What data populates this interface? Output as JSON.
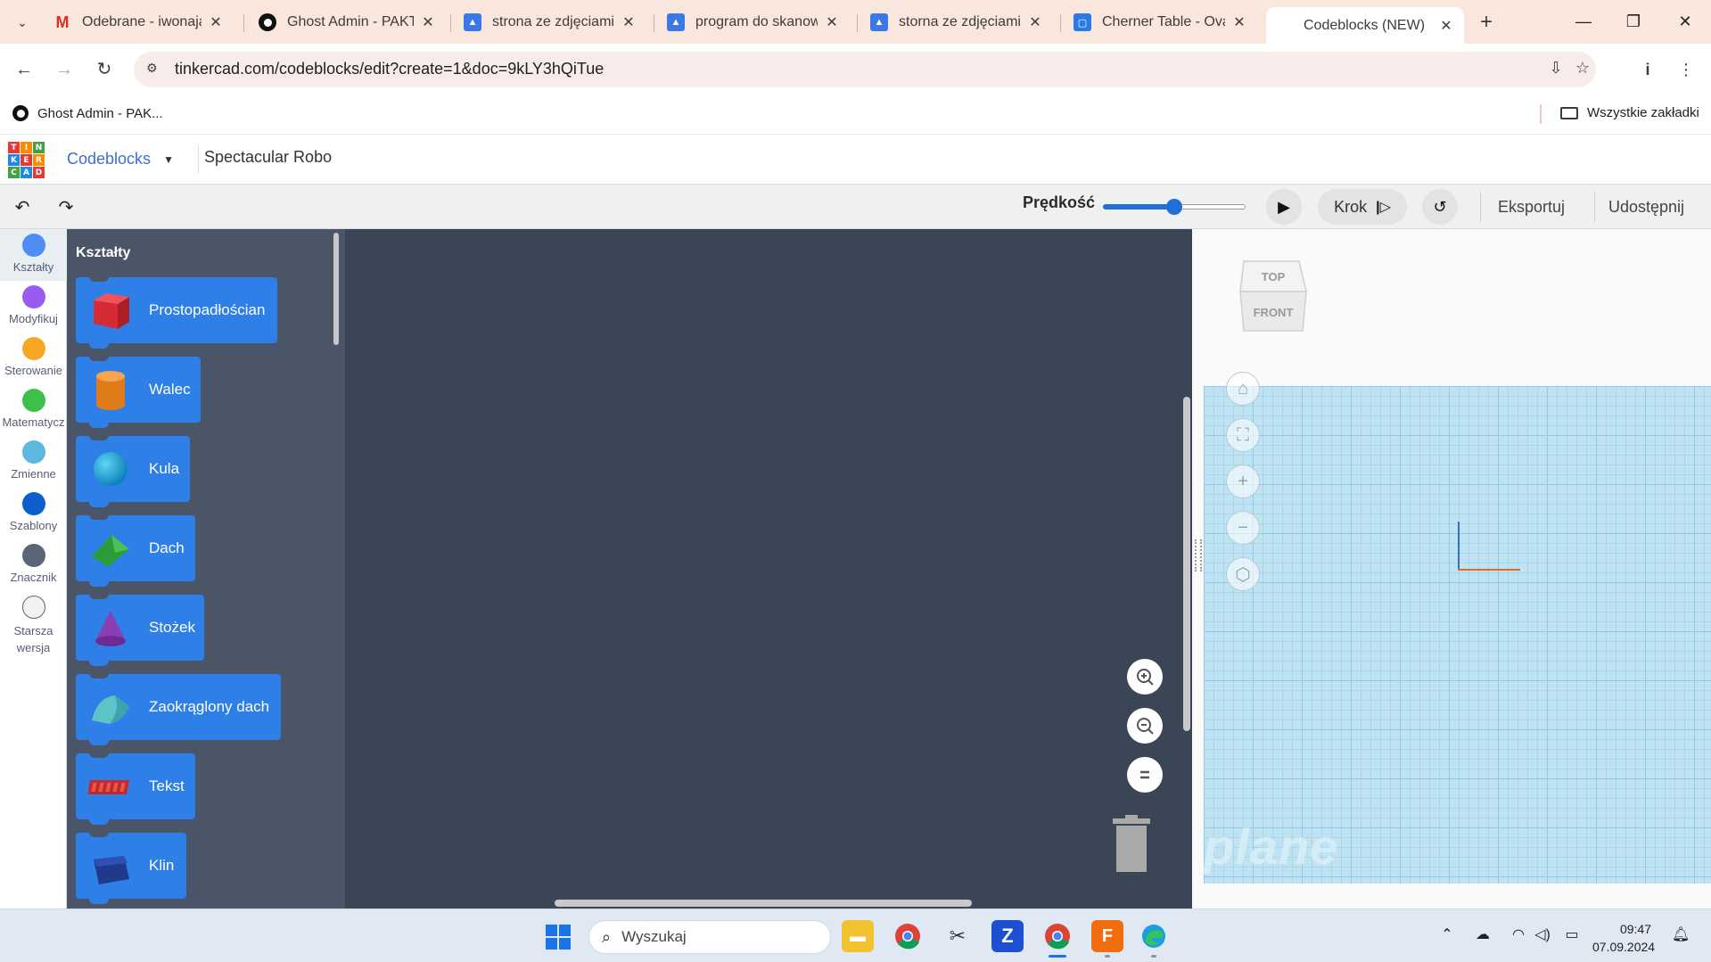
{
  "browser": {
    "tabs": [
      {
        "title": "Odebrane - iwonajar",
        "icon": "gmail-icon"
      },
      {
        "title": "Ghost Admin - PAKT",
        "icon": "ghost-icon"
      },
      {
        "title": "strona ze zdjęciami r",
        "icon": "docs-icon"
      },
      {
        "title": "program do skanowa",
        "icon": "docs-icon"
      },
      {
        "title": "storna ze zdjęciami r",
        "icon": "docs-icon"
      },
      {
        "title": "Cherner Table - Oval",
        "icon": "page-icon"
      },
      {
        "title": "Codeblocks (NEW)",
        "icon": "tinkercad-icon",
        "active": true
      }
    ],
    "url": "tinkercad.com/codeblocks/edit?create=1&doc=9kLY3hQiTue",
    "bookmarks": [
      {
        "label": "Ghost Admin - PAK..."
      }
    ],
    "all_bookmarks_label": "Wszystkie zakładki"
  },
  "app": {
    "logo_letters": [
      "T",
      "I",
      "N",
      "K",
      "E",
      "R",
      "C",
      "A",
      "D"
    ],
    "mode": "Codeblocks",
    "design_title": "Spectacular Robo",
    "toolbar": {
      "speed_label": "Prędkość",
      "speed_value": 0.5,
      "step_label": "Krok",
      "export_label": "Eksportuj",
      "share_label": "Udostępnij"
    }
  },
  "categories": [
    {
      "label": "Kształty",
      "color": "#4f8df5",
      "active": true
    },
    {
      "label": "Modyfikuj",
      "color": "#9a5cf0"
    },
    {
      "label": "Sterowanie",
      "color": "#f5a623"
    },
    {
      "label": "Matematycz",
      "color": "#3cc04a"
    },
    {
      "label": "Zmienne",
      "color": "#5cb8df"
    },
    {
      "label": "Szablony",
      "color": "#0d5fcc"
    },
    {
      "label": "Znacznik",
      "color": "#5a6678"
    },
    {
      "label": "Starsza wersja",
      "color": "#f2f2f2"
    }
  ],
  "flyout": {
    "title": "Kształty",
    "blocks": [
      {
        "label": "Prostopadłościan",
        "shape": "box"
      },
      {
        "label": "Walec",
        "shape": "cylinder"
      },
      {
        "label": "Kula",
        "shape": "sphere"
      },
      {
        "label": "Dach",
        "shape": "roof"
      },
      {
        "label": "Stożek",
        "shape": "cone"
      },
      {
        "label": "Zaokrąglony dach",
        "shape": "round-roof"
      },
      {
        "label": "Tekst",
        "shape": "text"
      },
      {
        "label": "Klin",
        "shape": "wedge"
      }
    ]
  },
  "viewer": {
    "viewcube_top": "TOP",
    "viewcube_front": "FRONT",
    "plane_label": "plane"
  },
  "taskbar": {
    "search_placeholder": "Wyszukaj",
    "time": "09:47",
    "date": "07.09.2024"
  }
}
